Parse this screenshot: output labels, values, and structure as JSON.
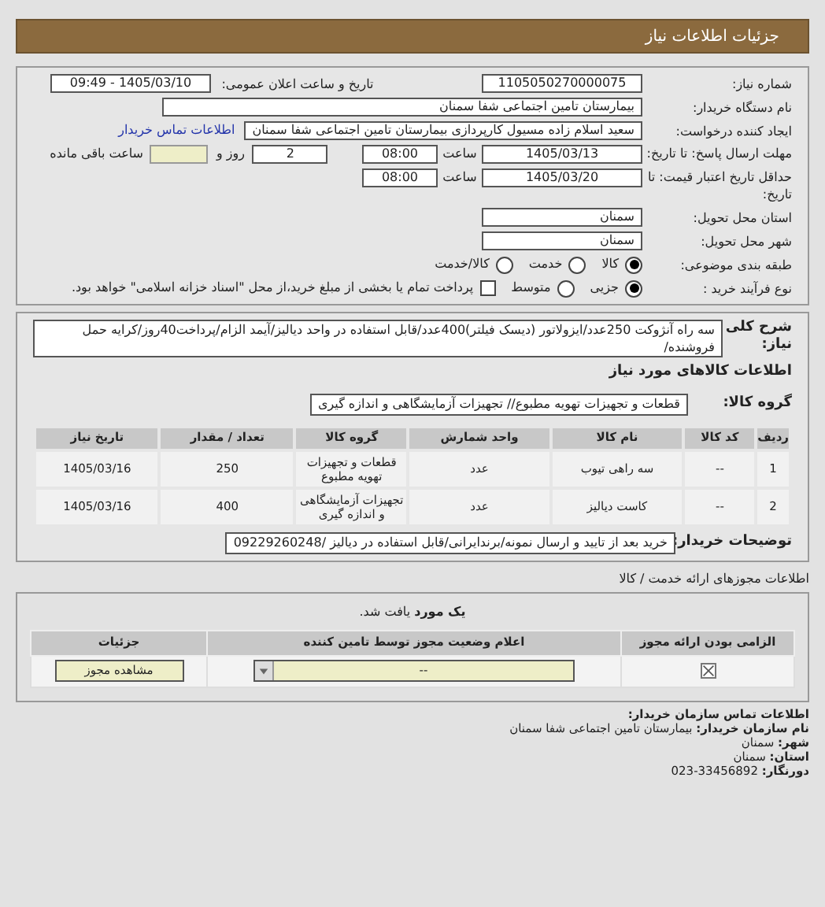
{
  "header": {
    "title": "جزئیات اطلاعات نیاز"
  },
  "need_number": {
    "label": "شماره نیاز:",
    "value": "1105050270000075"
  },
  "announce": {
    "label": "تاریخ و ساعت اعلان عمومی:",
    "value": "1405/03/10 - 09:49"
  },
  "buyer_org": {
    "label": "نام دستگاه خریدار:",
    "value": "بیمارستان تامین اجتماعی شفا سمنان"
  },
  "requester": {
    "label": "ایجاد کننده درخواست:",
    "value": "سعید اسلام زاده مسیول کارپردازی بیمارستان تامین اجتماعی شفا سمنان",
    "link": "اطلاعات تماس خریدار"
  },
  "deadline": {
    "label": "مهلت ارسال پاسخ: تا تاریخ:",
    "date": "1405/03/13",
    "time_label": "ساعت",
    "time": "08:00",
    "days": "2",
    "days_suffix": "روز و",
    "remaining_label": "ساعت باقی مانده"
  },
  "validity": {
    "label": "حداقل تاریخ اعتبار قیمت: تا تاریخ:",
    "date": "1405/03/20",
    "time_label": "ساعت",
    "time": "08:00"
  },
  "province": {
    "label": "استان محل تحویل:",
    "value": "سمنان"
  },
  "city": {
    "label": "شهر محل تحویل:",
    "value": "سمنان"
  },
  "category": {
    "label": "طبقه بندی موضوعی:",
    "options": [
      {
        "label": "کالا",
        "selected": true
      },
      {
        "label": "خدمت",
        "selected": false
      },
      {
        "label": "کالا/خدمت",
        "selected": false
      }
    ]
  },
  "process": {
    "label": "نوع فرآیند خرید :",
    "options": [
      {
        "label": "جزیی",
        "selected": true
      },
      {
        "label": "متوسط",
        "selected": false
      }
    ],
    "payment": {
      "label": "پرداخت تمام یا بخشی از مبلغ خرید،از محل \"اسناد خزانه اسلامی\" خواهد بود.",
      "checked": false
    }
  },
  "description": {
    "label": "شرح کلی نیاز:",
    "value": "سه راه آنژوکت 250عدد/ایزولاتور (دیسک فیلتر)400عدد/قابل استفاده در واحد دیالیز/آیمد الزام/پرداخت40روز/کرایه حمل فروشنده/"
  },
  "items_title": "اطلاعات کالاهای مورد نیاز",
  "goods_group": {
    "label": "گروه کالا:",
    "value": "قطعات و تجهیزات تهویه مطبوع// تجهیزات آزمایشگاهی و اندازه گیری"
  },
  "items_table": {
    "columns": [
      "ردیف",
      "کد کالا",
      "نام کالا",
      "واحد شمارش",
      "گروه کالا",
      "تعداد / مقدار",
      "تاریخ نیاز"
    ],
    "rows": [
      [
        "1",
        "--",
        "سه راهی تیوب",
        "عدد",
        "قطعات و تجهیزات تهویه مطبوع",
        "250",
        "1405/03/16"
      ],
      [
        "2",
        "--",
        "کاست دیالیز",
        "عدد",
        "تجهیزات آزمایشگاهی و اندازه گیری",
        "400",
        "1405/03/16"
      ]
    ]
  },
  "buyer_notes": {
    "label": "توضیحات خریدار:",
    "value": "خرید بعد از تایید و ارسال نمونه/برندایرانی/قابل استفاده در دیالیز /09229260248"
  },
  "permits": {
    "title": "اطلاعات مجوزهای ارائه خدمت / کالا",
    "found": "**یک مورد** یافت شد.",
    "columns": [
      "الزامی بودن ارائه مجوز",
      "اعلام وضعیت مجوز توسط تامین کننده",
      "جزئیات"
    ],
    "rows": [
      {
        "required": true,
        "status": "--",
        "button": "مشاهده مجوز"
      }
    ]
  },
  "contact": {
    "title": "اطلاعات تماس سازمان خریدار:",
    "lines": [
      {
        "label": "نام سازمان خریدار:",
        "value": "بیمارستان تامین اجتماعی شفا سمنان"
      },
      {
        "label": "شهر:",
        "value": "سمنان"
      },
      {
        "label": "استان:",
        "value": "سمنان"
      },
      {
        "label": "دورنگار:",
        "value": "023-33456892"
      }
    ]
  }
}
